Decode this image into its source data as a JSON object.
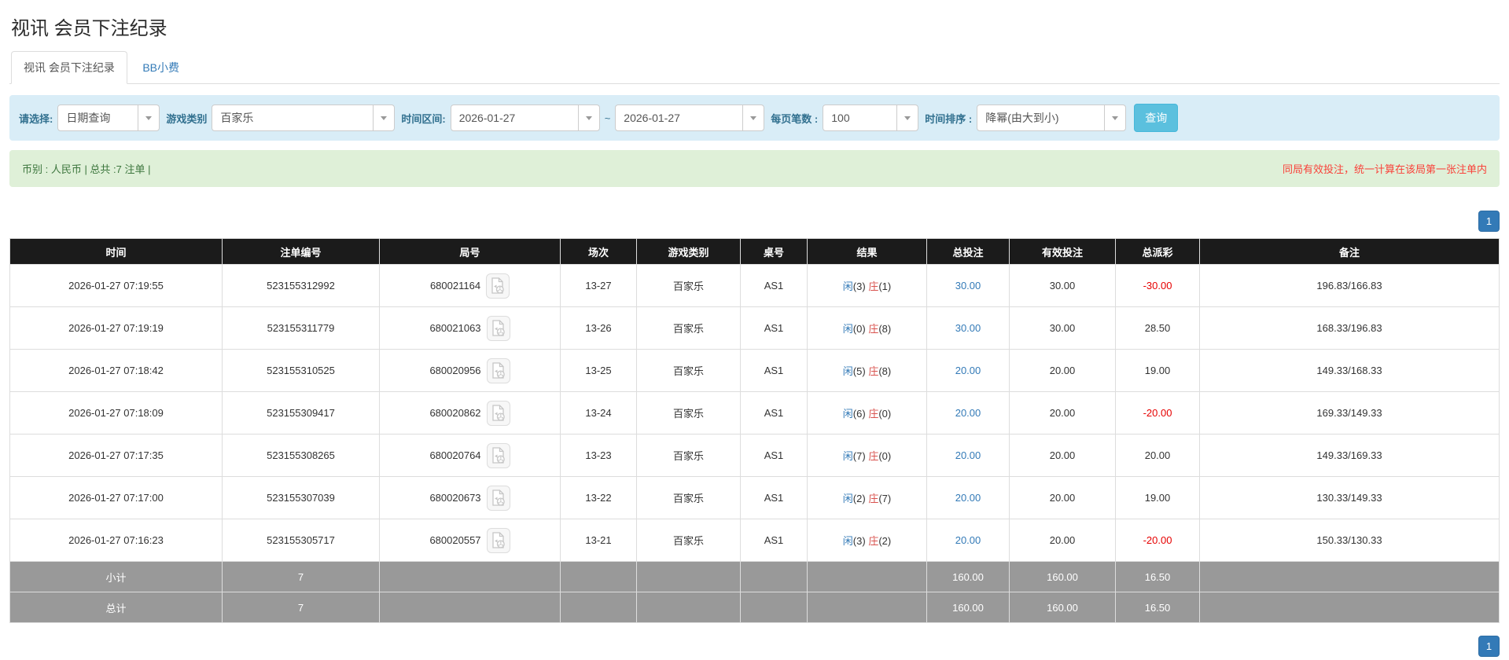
{
  "page": {
    "title": "视讯 会员下注纪录"
  },
  "tabs": {
    "records": "视讯 会员下注纪录",
    "bb_tip": "BB小费"
  },
  "filters": {
    "select_label": "请选择:",
    "select_value": "日期查询",
    "game_label": "游戏类别",
    "game_value": "百家乐",
    "range_label": "时间区间:",
    "date_from": "2026-01-27",
    "range_separator": "~",
    "date_to": "2026-01-27",
    "page_size_label": "每页笔数 :",
    "page_size_value": "100",
    "sort_label": "时间排序 :",
    "sort_value": "降幂(由大到小)",
    "search_button": "查询"
  },
  "infobar": {
    "left": "币别 : 人民币 | 总共 :7 注单 |",
    "right": "同局有效投注，统一计算在该局第一张注单内"
  },
  "pagination": {
    "page": "1"
  },
  "strings": {
    "player": "闲",
    "banker": "庄"
  },
  "colors": {
    "accent_blue": "#337ab7",
    "info_bg": "#d9edf7",
    "success_bg": "#dff0d8",
    "header_bg": "#1b1b1b",
    "footer_bg": "#999999",
    "negative_red": "#e60000",
    "banker_red": "#d9534f",
    "button_info": "#5bc0de"
  },
  "icons": {
    "dropdown_caret": "caret-down",
    "video_record": "video-file-icon"
  },
  "table": {
    "headers": [
      "时间",
      "注单编号",
      "局号",
      "场次",
      "游戏类别",
      "桌号",
      "结果",
      "总投注",
      "有效投注",
      "总派彩",
      "备注"
    ],
    "rows": [
      {
        "time": "2026-01-27 07:19:55",
        "bet_no": "523155312992",
        "round_no": "680021164",
        "session": "13-27",
        "game": "百家乐",
        "table_no": "AS1",
        "result": {
          "p": "(3)",
          "b": "(1)"
        },
        "total": "30.00",
        "valid": "30.00",
        "payout": "-30.00",
        "remark": "196.83/166.83"
      },
      {
        "time": "2026-01-27 07:19:19",
        "bet_no": "523155311779",
        "round_no": "680021063",
        "session": "13-26",
        "game": "百家乐",
        "table_no": "AS1",
        "result": {
          "p": "(0)",
          "b": "(8)"
        },
        "total": "30.00",
        "valid": "30.00",
        "payout": "28.50",
        "remark": "168.33/196.83"
      },
      {
        "time": "2026-01-27 07:18:42",
        "bet_no": "523155310525",
        "round_no": "680020956",
        "session": "13-25",
        "game": "百家乐",
        "table_no": "AS1",
        "result": {
          "p": "(5)",
          "b": "(8)"
        },
        "total": "20.00",
        "valid": "20.00",
        "payout": "19.00",
        "remark": "149.33/168.33"
      },
      {
        "time": "2026-01-27 07:18:09",
        "bet_no": "523155309417",
        "round_no": "680020862",
        "session": "13-24",
        "game": "百家乐",
        "table_no": "AS1",
        "result": {
          "p": "(6)",
          "b": "(0)"
        },
        "total": "20.00",
        "valid": "20.00",
        "payout": "-20.00",
        "remark": "169.33/149.33"
      },
      {
        "time": "2026-01-27 07:17:35",
        "bet_no": "523155308265",
        "round_no": "680020764",
        "session": "13-23",
        "game": "百家乐",
        "table_no": "AS1",
        "result": {
          "p": "(7)",
          "b": "(0)"
        },
        "total": "20.00",
        "valid": "20.00",
        "payout": "20.00",
        "remark": "149.33/169.33"
      },
      {
        "time": "2026-01-27 07:17:00",
        "bet_no": "523155307039",
        "round_no": "680020673",
        "session": "13-22",
        "game": "百家乐",
        "table_no": "AS1",
        "result": {
          "p": "(2)",
          "b": "(7)"
        },
        "total": "20.00",
        "valid": "20.00",
        "payout": "19.00",
        "remark": "130.33/149.33"
      },
      {
        "time": "2026-01-27 07:16:23",
        "bet_no": "523155305717",
        "round_no": "680020557",
        "session": "13-21",
        "game": "百家乐",
        "table_no": "AS1",
        "result": {
          "p": "(3)",
          "b": "(2)"
        },
        "total": "20.00",
        "valid": "20.00",
        "payout": "-20.00",
        "remark": "150.33/130.33"
      }
    ],
    "footers": [
      {
        "label": "小计",
        "count": "7",
        "total": "160.00",
        "valid": "160.00",
        "payout": "16.50"
      },
      {
        "label": "总计",
        "count": "7",
        "total": "160.00",
        "valid": "160.00",
        "payout": "16.50"
      }
    ]
  }
}
